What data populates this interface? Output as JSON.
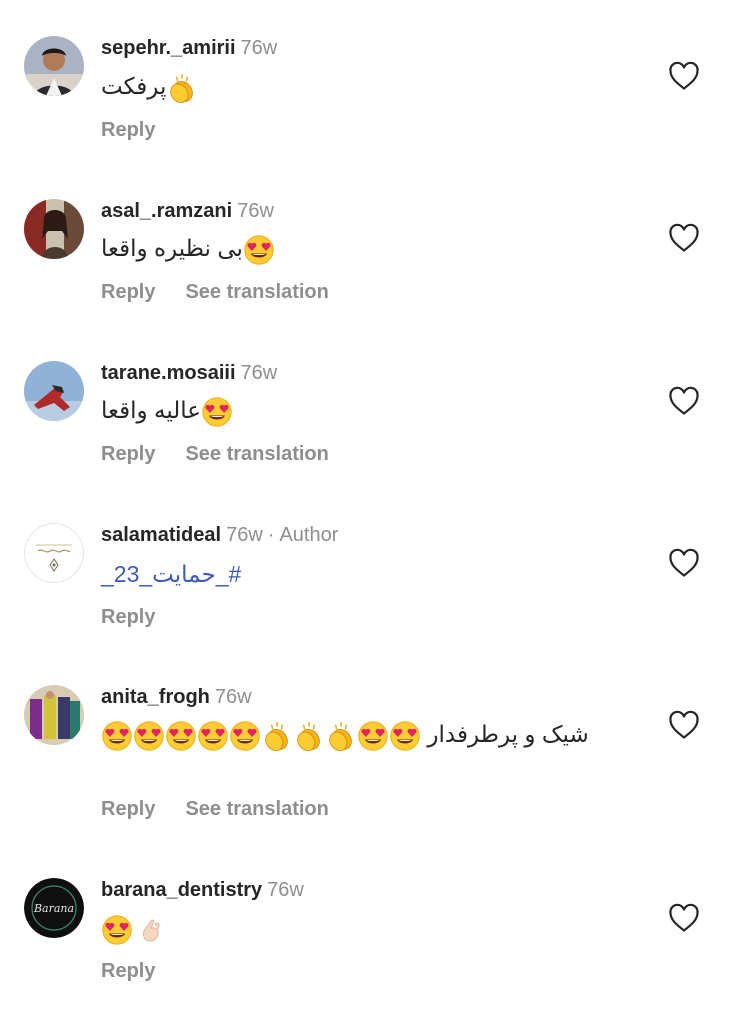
{
  "comments": [
    {
      "username": "sepehr._amirii",
      "time": "76w",
      "text": "پرفکت",
      "reply_label": "Reply",
      "translate_label": "",
      "like_icon": "heart-outline-icon"
    },
    {
      "username": "asal_.ramzani",
      "time": "76w",
      "text": "بی نظیره واقعا",
      "reply_label": "Reply",
      "translate_label": "See translation",
      "like_icon": "heart-outline-icon"
    },
    {
      "username": "tarane.mosaiii",
      "time": "76w",
      "text": "عالیه واقعا",
      "reply_label": "Reply",
      "translate_label": "See translation",
      "like_icon": "heart-outline-icon"
    },
    {
      "username": "salamatideal",
      "time": "76w",
      "dot": "·",
      "author": "Author",
      "text": "#_حمایت_23_",
      "reply_label": "Reply",
      "translate_label": "",
      "like_icon": "heart-outline-icon"
    },
    {
      "username": "anita_frogh",
      "time": "76w",
      "text": "شیک و پرطرفدار",
      "reply_label": "Reply",
      "translate_label": "See translation",
      "like_icon": "heart-outline-icon"
    },
    {
      "username": "barana_dentistry",
      "time": "76w",
      "avatar_logo_text": "Barana",
      "reply_label": "Reply",
      "translate_label": "",
      "like_icon": "heart-outline-icon"
    }
  ],
  "colors": {
    "text": "#262626",
    "muted": "#8e8e8e",
    "hashtag": "#3b5bbf",
    "emoji_face": "#ffcc33",
    "emoji_heart": "#e0245e"
  }
}
